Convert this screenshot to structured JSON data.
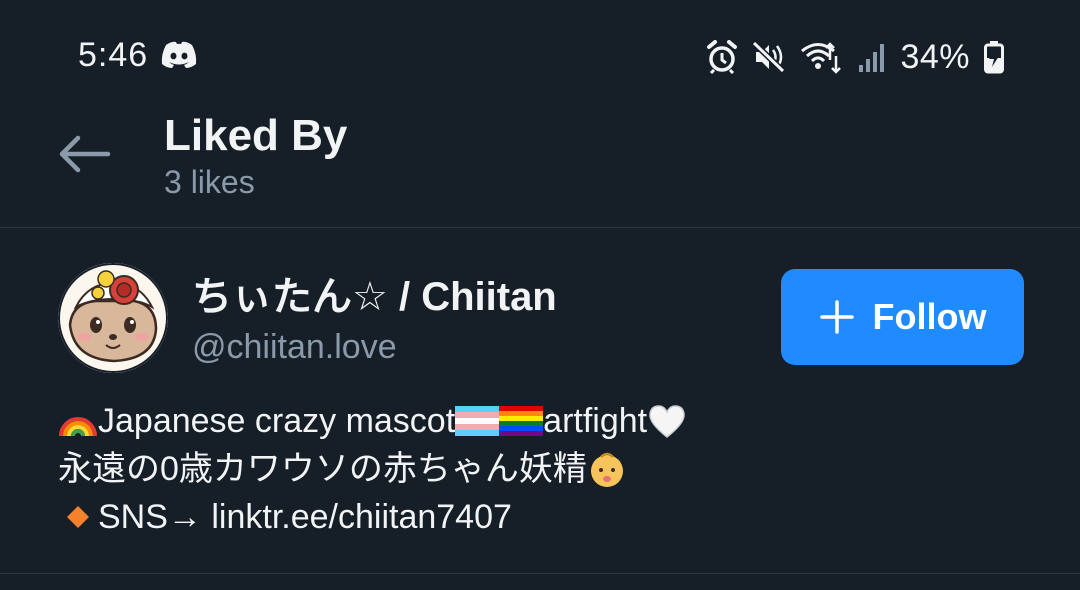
{
  "status_bar": {
    "time": "5:46",
    "battery": "34%",
    "icons": [
      "discord-icon",
      "alarm-icon",
      "mute-icon",
      "wifi-icon",
      "signal-icon",
      "battery-charging-icon"
    ]
  },
  "header": {
    "title": "Liked By",
    "subtitle": "3 likes",
    "back_icon": "arrow-left-icon"
  },
  "user": {
    "display_name": "ちぃたん☆ / Chiitan",
    "handle": "@chiitan.love",
    "follow_label": "Follow",
    "bio": {
      "line1": "Japanese crazy mascot",
      "line1_suffix": "artfight",
      "line2": "永遠の0歳カワウソの赤ちゃん妖精",
      "line3": "SNS→ linktr.ee/chiitan7407"
    }
  },
  "colors": {
    "background": "#161e27",
    "text_primary": "#f1f3f5",
    "text_secondary": "#8a9aab",
    "accent": "#208bfe",
    "divider": "#2b3744"
  }
}
